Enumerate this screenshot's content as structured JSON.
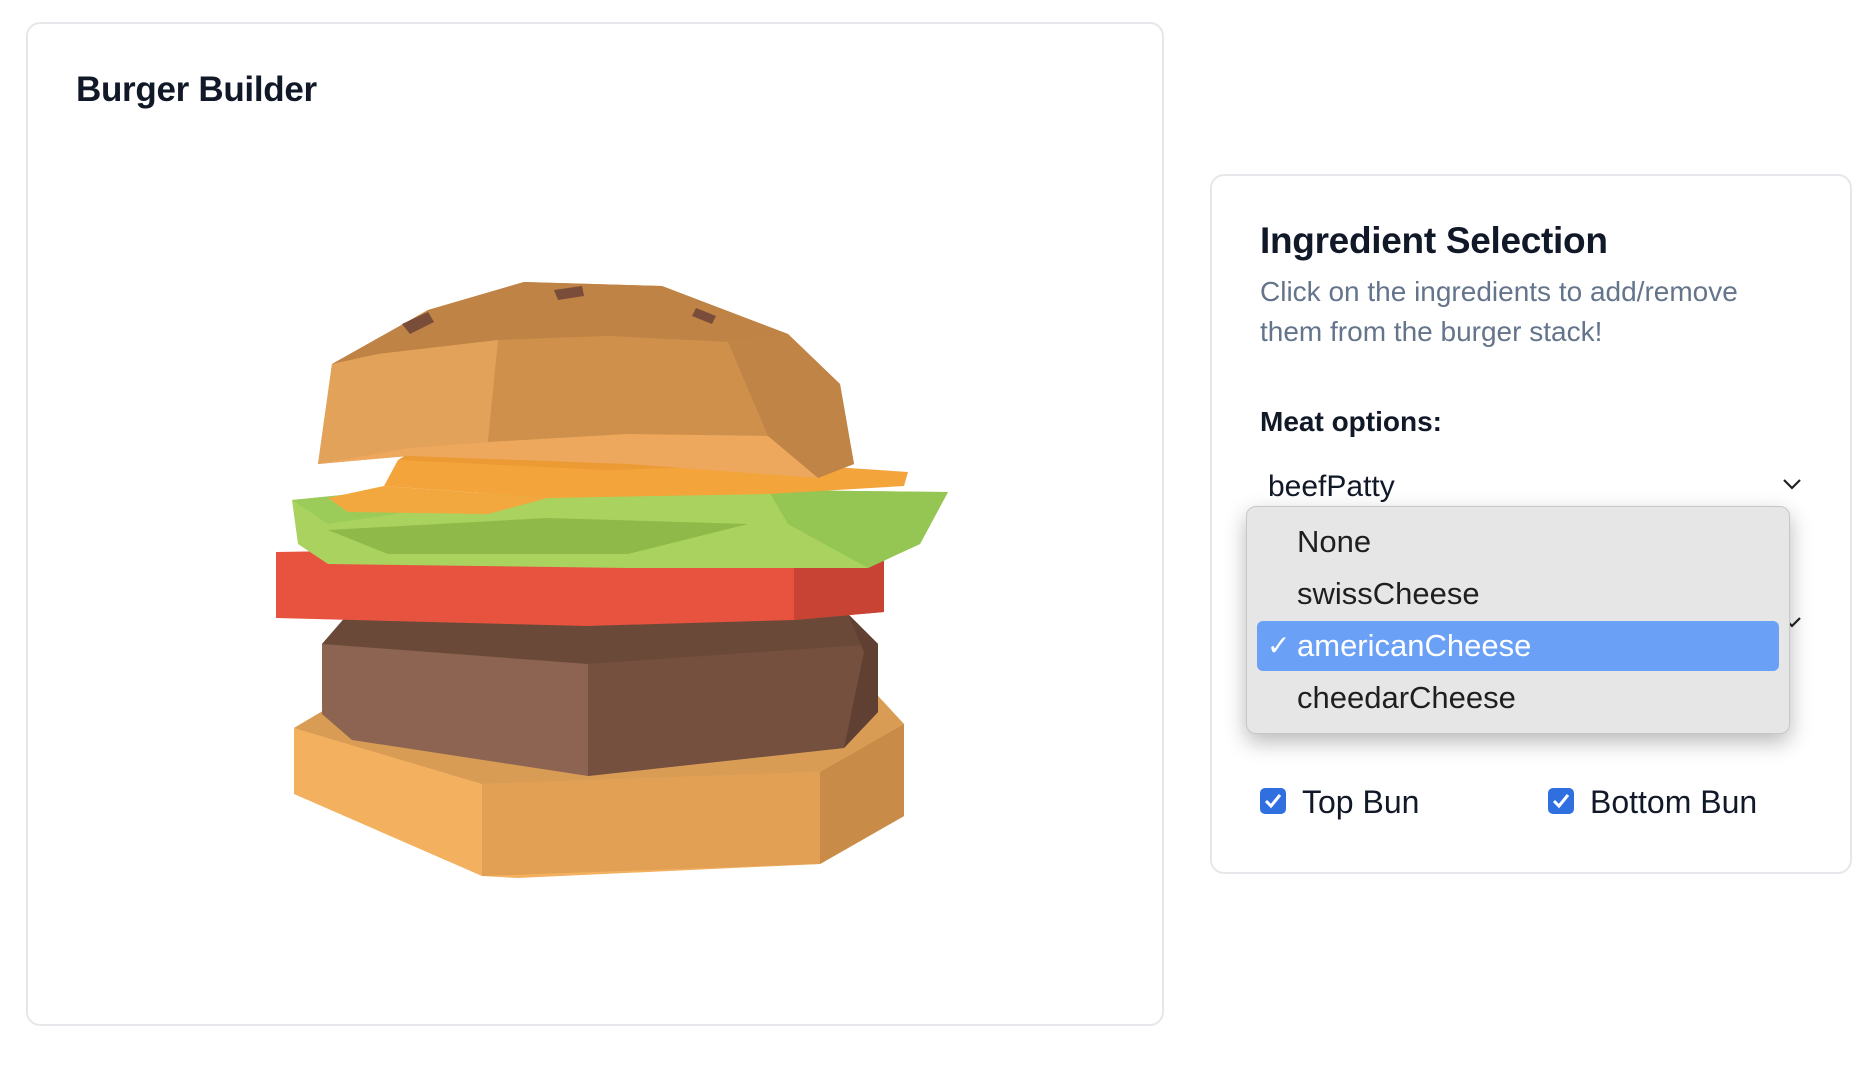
{
  "builder": {
    "title": "Burger Builder",
    "burger_image": {
      "layers_top_to_bottom": [
        "top bun",
        "cheese",
        "lettuce",
        "tomato",
        "beef patty",
        "bottom bun"
      ]
    }
  },
  "selection": {
    "title": "Ingredient Selection",
    "description": "Click on the ingredients to add/remove them from the burger stack!",
    "meat_label": "Meat options:",
    "meat_value": "beefPatty",
    "cheese_value": "americanCheese",
    "cheese_options": [
      {
        "label": "None",
        "selected": false
      },
      {
        "label": "swissCheese",
        "selected": false
      },
      {
        "label": "americanCheese",
        "selected": true
      },
      {
        "label": "cheedarCheese",
        "selected": false
      }
    ],
    "check_mark": "✓",
    "top_bun": {
      "label": "Top Bun",
      "checked": true
    },
    "bottom_bun": {
      "label": "Bottom Bun",
      "checked": true
    }
  },
  "colors": {
    "accent": "#2f6fe0",
    "dropdown_highlight": "#6aa0f5",
    "bun": "#e9a656",
    "cheese": "#f0a03a",
    "lettuce": "#9bcc5a",
    "tomato": "#e85340",
    "patty": "#7a5241"
  }
}
